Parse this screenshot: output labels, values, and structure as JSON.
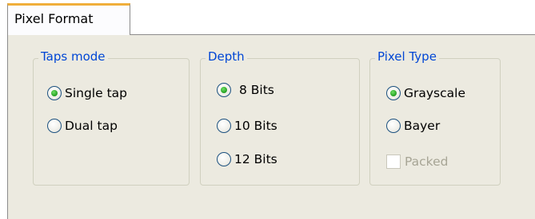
{
  "tab": {
    "label": "Pixel Format"
  },
  "groups": {
    "taps": {
      "title": "Taps mode",
      "options": [
        {
          "label": "Single tap",
          "checked": true
        },
        {
          "label": "Dual tap",
          "checked": false
        }
      ]
    },
    "depth": {
      "title": "Depth",
      "options": [
        {
          "label": "8 Bits",
          "checked": true
        },
        {
          "label": "10 Bits",
          "checked": false
        },
        {
          "label": "12 Bits",
          "checked": false
        }
      ]
    },
    "pixel_type": {
      "title": "Pixel Type",
      "options": [
        {
          "label": "Grayscale",
          "checked": true
        },
        {
          "label": "Bayer",
          "checked": false
        }
      ],
      "packed": {
        "label": "Packed",
        "checked": false,
        "enabled": false
      }
    }
  },
  "colors": {
    "group_title": "#0046d5",
    "tab_accent": "#f0ae3b",
    "panel_bg": "#eceae0",
    "radio_dot": "#2da72a"
  }
}
